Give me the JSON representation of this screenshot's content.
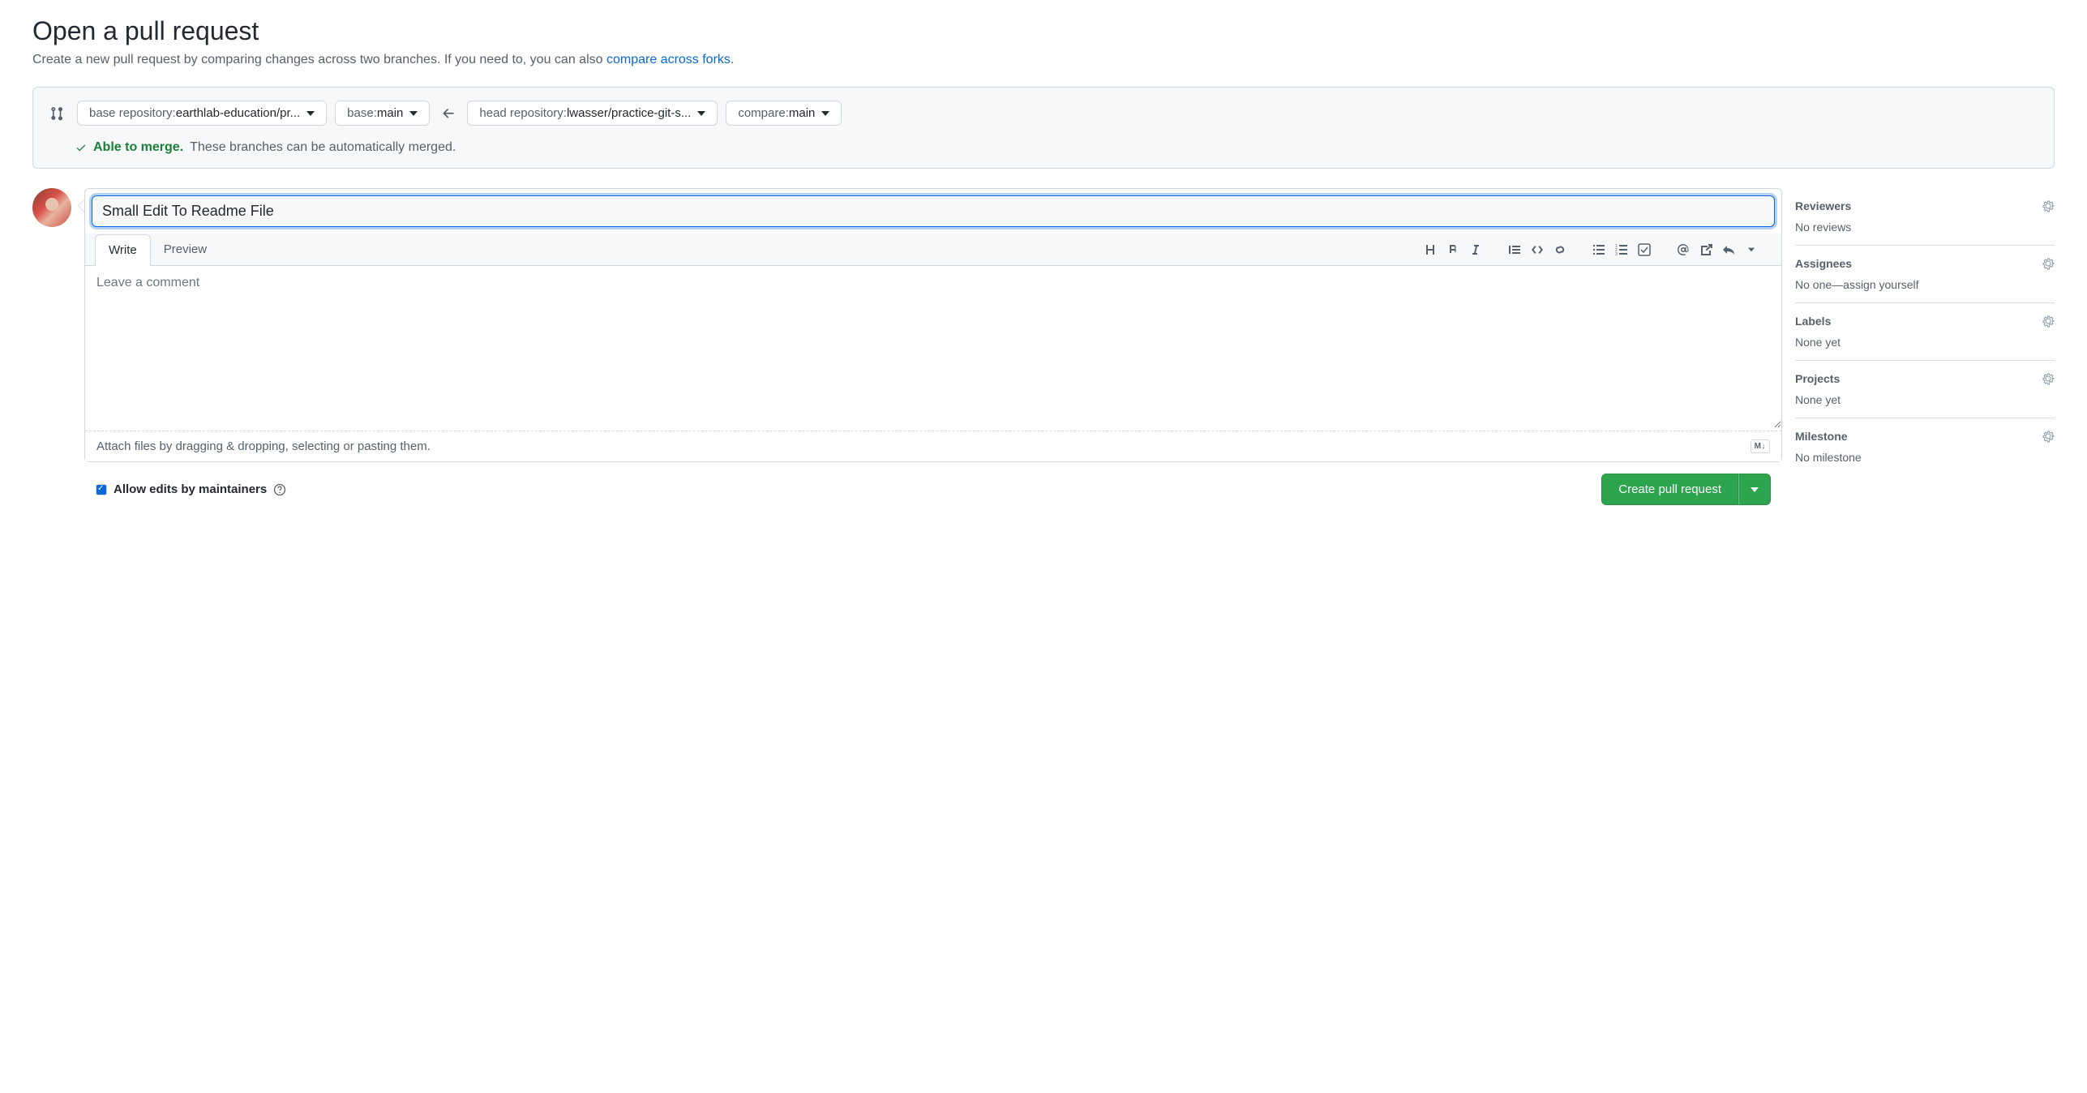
{
  "header": {
    "title": "Open a pull request",
    "subtitle_pre": "Create a new pull request by comparing changes across two branches. If you need to, you can also ",
    "subtitle_link": "compare across forks",
    "subtitle_post": "."
  },
  "compare": {
    "base_repo_label": "base repository: ",
    "base_repo_value": "earthlab-education/pr...",
    "base_branch_label": "base: ",
    "base_branch_value": "main",
    "head_repo_label": "head repository: ",
    "head_repo_value": "lwasser/practice-git-s...",
    "compare_branch_label": "compare: ",
    "compare_branch_value": "main",
    "merge_able": "Able to merge.",
    "merge_msg": "These branches can be automatically merged."
  },
  "pr": {
    "title_value": "Small Edit To Readme File",
    "tabs": {
      "write": "Write",
      "preview": "Preview"
    },
    "body_placeholder": "Leave a comment",
    "attach_hint": "Attach files by dragging & dropping, selecting or pasting them.",
    "markdown_badge": "M↓",
    "allow_edits_label": "Allow edits by maintainers",
    "create_button": "Create pull request"
  },
  "sidebar": {
    "reviewers": {
      "title": "Reviewers",
      "body": "No reviews"
    },
    "assignees": {
      "title": "Assignees",
      "body_pre": "No one—",
      "assign_self": "assign yourself"
    },
    "labels": {
      "title": "Labels",
      "body": "None yet"
    },
    "projects": {
      "title": "Projects",
      "body": "None yet"
    },
    "milestone": {
      "title": "Milestone",
      "body": "No milestone"
    }
  }
}
